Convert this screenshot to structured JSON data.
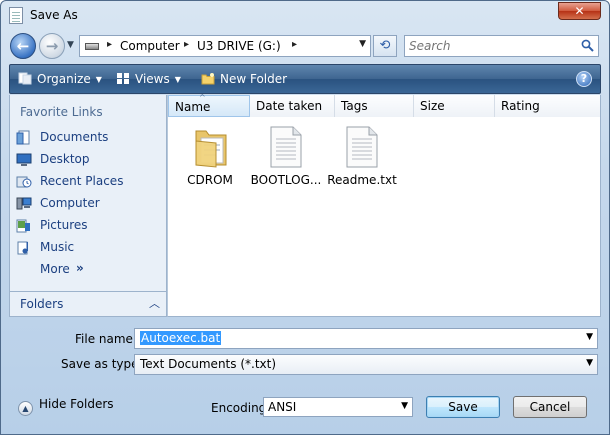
{
  "window": {
    "title": "Save As",
    "close_label": "✕"
  },
  "address_bar": {
    "crumbs": [
      "Computer",
      "U3 DRIVE (G:)"
    ],
    "search_placeholder": "Search"
  },
  "toolbar": {
    "organize_label": "Organize",
    "views_label": "Views",
    "new_folder_label": "New Folder",
    "help_label": "?"
  },
  "nav_pane": {
    "heading": "Favorite Links",
    "links": [
      {
        "label": "Documents",
        "icon": "documents-icon"
      },
      {
        "label": "Desktop",
        "icon": "desktop-icon"
      },
      {
        "label": "Recent Places",
        "icon": "recent-places-icon"
      },
      {
        "label": "Computer",
        "icon": "computer-icon"
      },
      {
        "label": "Pictures",
        "icon": "pictures-icon"
      },
      {
        "label": "Music",
        "icon": "music-icon"
      }
    ],
    "more_label": "More",
    "more_arrow": "»",
    "folders_label": "Folders"
  },
  "file_list": {
    "columns": [
      "Name",
      "Date taken",
      "Tags",
      "Size",
      "Rating"
    ],
    "sorted_column": "Name",
    "items": [
      {
        "name": "CDROM",
        "type": "folder"
      },
      {
        "name": "BOOTLOG...",
        "type": "text-file"
      },
      {
        "name": "Readme.txt",
        "type": "text-file"
      }
    ]
  },
  "form": {
    "file_name_label": "File name:",
    "file_name_value": "Autoexec.bat",
    "save_as_type_label": "Save as type:",
    "save_as_type_value": "Text Documents (*.txt)",
    "encoding_label": "Encoding:",
    "encoding_value": "ANSI",
    "hide_folders_label": "Hide Folders",
    "save_label": "Save",
    "cancel_label": "Cancel"
  },
  "colors": {
    "toolbar": "#3e6590",
    "nav_link": "#1b3f80",
    "selection": "#3399ff"
  }
}
